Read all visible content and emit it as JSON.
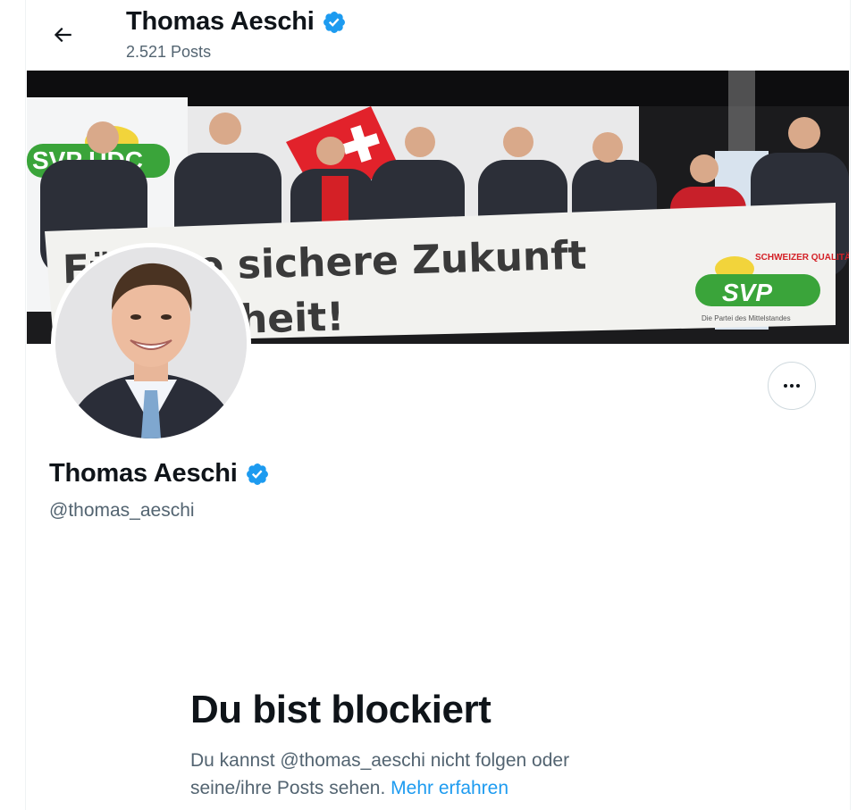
{
  "header": {
    "name": "Thomas Aeschi",
    "post_count": "2.521 Posts"
  },
  "banner": {
    "slogan_line1": "Fü   eine sichere Zukunft",
    "slogan_line2": "heit!",
    "left_sign": "SVP UDC",
    "logo_top": "SCHWEIZER QUALITÄT",
    "logo_text": "SVP",
    "logo_sub": "Die Partei des Mittelstandes"
  },
  "profile": {
    "name": "Thomas Aeschi",
    "handle": "@thomas_aeschi"
  },
  "blocked": {
    "title": "Du bist blockiert",
    "text": "Du kannst @thomas_aeschi nicht folgen oder seine/ihre Posts sehen.",
    "link": "Mehr erfahren"
  },
  "colors": {
    "verified": "#1d9bf0",
    "link": "#1d9bf0",
    "secondary_text": "#536471"
  },
  "icons": {
    "back": "arrow-left-icon",
    "verified": "verified-badge-icon",
    "more": "more-horizontal-icon"
  }
}
